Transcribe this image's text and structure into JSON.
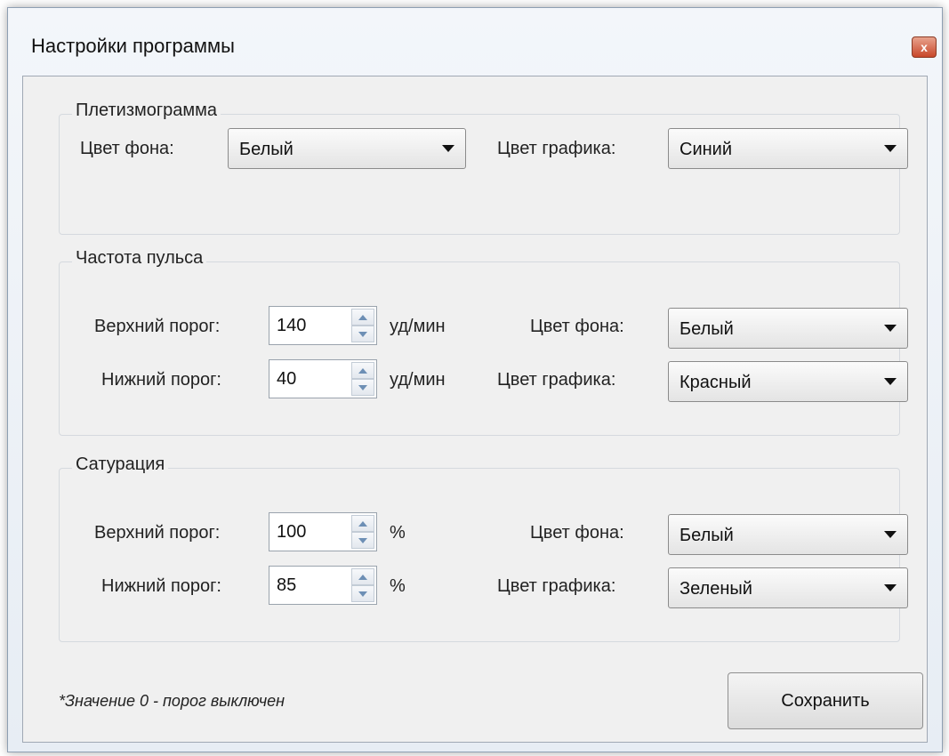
{
  "window": {
    "title": "Настройки программы",
    "close_glyph": "x"
  },
  "pleth": {
    "legend": "Плетизмограмма",
    "bg_label": "Цвет фона:",
    "bg_value": "Белый",
    "graph_label": "Цвет графика:",
    "graph_value": "Синий"
  },
  "pulse": {
    "legend": "Частота пульса",
    "upper_label": "Верхний порог:",
    "upper_value": "140",
    "lower_label": "Нижний порог:",
    "lower_value": "40",
    "unit": "уд/мин",
    "bg_label": "Цвет фона:",
    "bg_value": "Белый",
    "graph_label": "Цвет графика:",
    "graph_value": "Красный"
  },
  "sat": {
    "legend": "Сатурация",
    "upper_label": "Верхний порог:",
    "upper_value": "100",
    "lower_label": "Нижний порог:",
    "lower_value": "85",
    "unit": "%",
    "bg_label": "Цвет фона:",
    "bg_value": "Белый",
    "graph_label": "Цвет графика:",
    "graph_value": "Зеленый"
  },
  "footer": {
    "note": "*Значение 0 - порог выключен",
    "save_label": "Сохранить"
  },
  "icons": [
    "close-icon",
    "chevron-down-icon",
    "spin-up-icon",
    "spin-down-icon"
  ]
}
